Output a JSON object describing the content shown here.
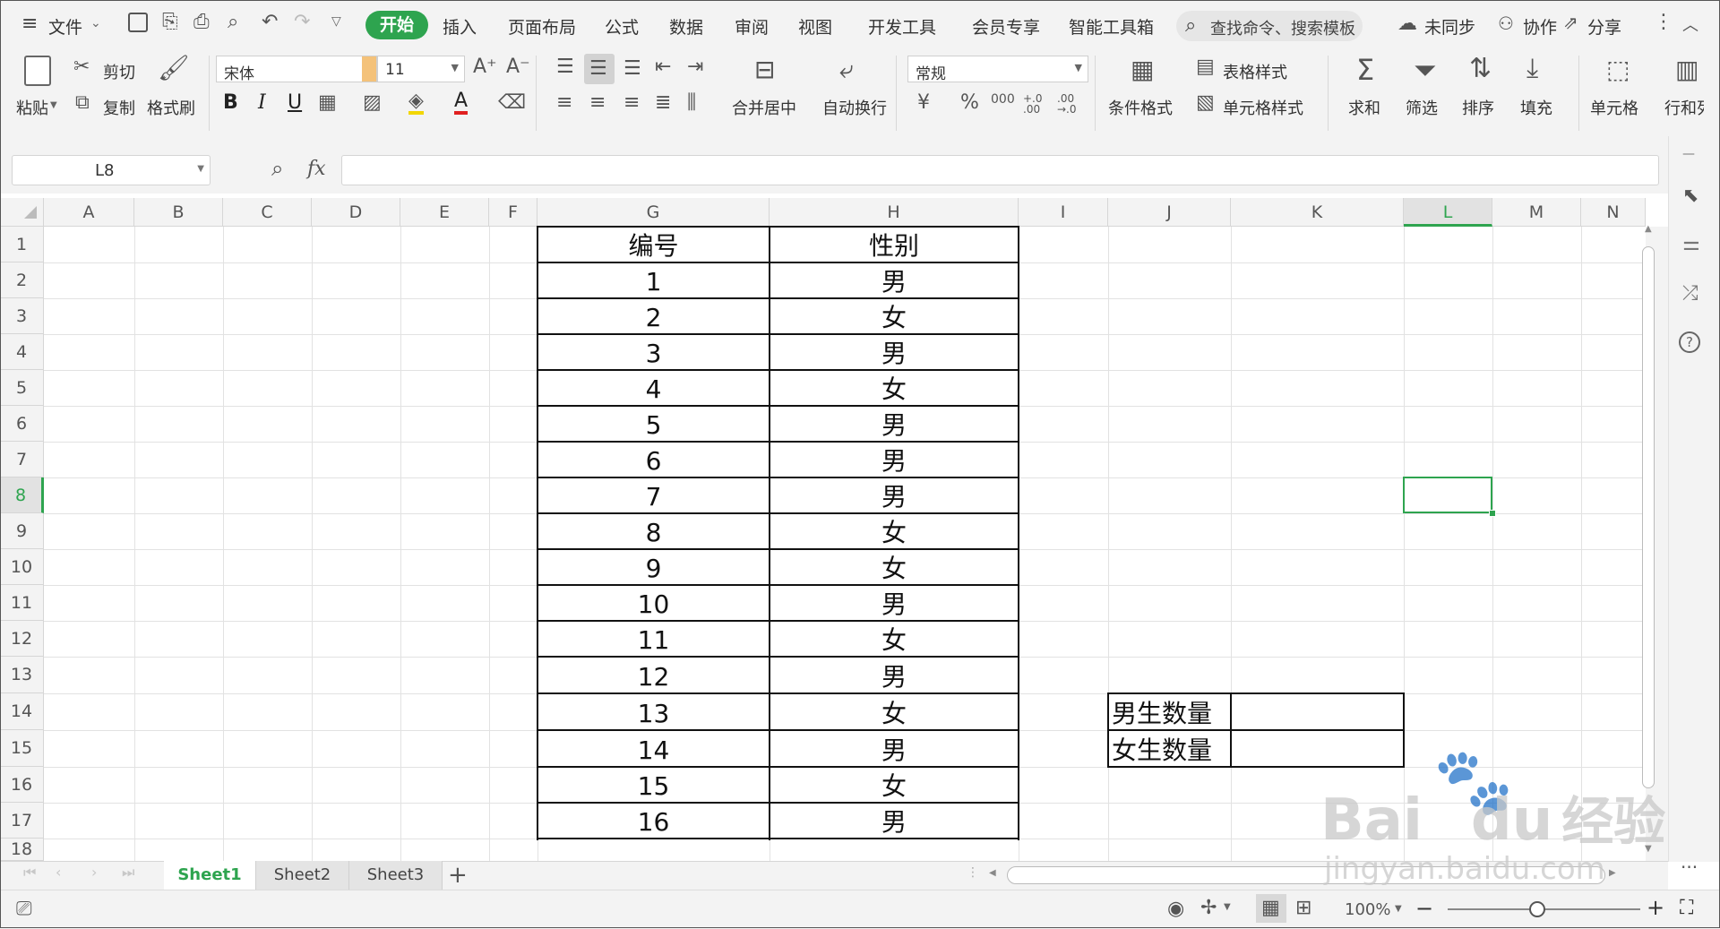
{
  "menu": {
    "file": "文件",
    "tabs": [
      "开始",
      "插入",
      "页面布局",
      "公式",
      "数据",
      "审阅",
      "视图",
      "开发工具",
      "会员专享",
      "智能工具箱"
    ],
    "search_placeholder": "查找命令、搜索模板",
    "sync": "未同步",
    "collab": "协作",
    "share": "分享"
  },
  "ribbon": {
    "paste": "粘贴",
    "cut": "剪切",
    "copy": "复制",
    "format_painter": "格式刷",
    "font_name": "宋体",
    "font_size": "11",
    "bold": "B",
    "italic": "I",
    "underline": "U",
    "merge_center": "合并居中",
    "wrap_text": "自动换行",
    "number_format": "常规",
    "currency": "¥",
    "percent": "%",
    "thousands": "000",
    "inc_decimal": "+.0 .00",
    "dec_decimal": ".00 →.0",
    "conditional_format": "条件格式",
    "table_style": "表格样式",
    "cell_style": "单元格样式",
    "sum": "求和",
    "filter": "筛选",
    "sort": "排序",
    "fill": "填充",
    "cell": "单元格",
    "row_col": "行和列"
  },
  "formula_bar": {
    "name_box": "L8",
    "fx": "fx",
    "formula": ""
  },
  "grid": {
    "columns": [
      "A",
      "B",
      "C",
      "D",
      "E",
      "F",
      "G",
      "H",
      "I",
      "J",
      "K",
      "L",
      "M",
      "N"
    ],
    "rows": [
      "1",
      "2",
      "3",
      "4",
      "5",
      "6",
      "7",
      "8",
      "9",
      "10",
      "11",
      "12",
      "13",
      "14",
      "15",
      "16",
      "17",
      "18"
    ],
    "selected_cell": "L8",
    "accent": "#2ea44f"
  },
  "table": {
    "headers": [
      "编号",
      "性别"
    ],
    "rows": [
      [
        "1",
        "男"
      ],
      [
        "2",
        "女"
      ],
      [
        "3",
        "男"
      ],
      [
        "4",
        "女"
      ],
      [
        "5",
        "男"
      ],
      [
        "6",
        "男"
      ],
      [
        "7",
        "男"
      ],
      [
        "8",
        "女"
      ],
      [
        "9",
        "女"
      ],
      [
        "10",
        "男"
      ],
      [
        "11",
        "女"
      ],
      [
        "12",
        "男"
      ],
      [
        "13",
        "女"
      ],
      [
        "14",
        "男"
      ],
      [
        "15",
        "女"
      ],
      [
        "16",
        "男"
      ]
    ]
  },
  "summary": {
    "male_label": "男生数量",
    "female_label": "女生数量",
    "male_value": "",
    "female_value": ""
  },
  "sheets": [
    "Sheet1",
    "Sheet2",
    "Sheet3"
  ],
  "active_sheet": "Sheet1",
  "status": {
    "zoom": "100%"
  },
  "watermark": {
    "brand": "Bai",
    "brand2": "du",
    "brand_cn": "经验",
    "url": "jingyan.baidu.com"
  }
}
